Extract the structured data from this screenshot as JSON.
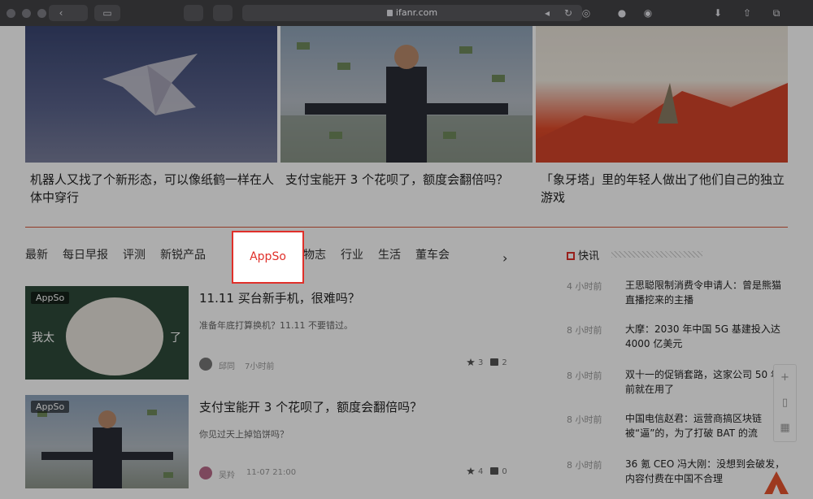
{
  "browser": {
    "url": "ifanr.com"
  },
  "hero": [
    {
      "title": "机器人又找了个新形态，可以像纸鹤一样在人体中穿行"
    },
    {
      "title": "支付宝能开 3 个花呗了，额度会翻倍吗？"
    },
    {
      "title": "「象牙塔」里的年轻人做出了他们自己的独立游戏"
    }
  ],
  "tabs": [
    "最新",
    "每日早报",
    "评测",
    "新锐产品",
    "AppSo",
    "玩物志",
    "行业",
    "生活",
    "董车会"
  ],
  "active_tab": "AppSo",
  "articles": [
    {
      "badge": "AppSo",
      "thumb_text_left": "我太",
      "thumb_text_right": "了",
      "title": "11.11 买台新手机，很难吗？",
      "desc": "准备年底打算换机？11.11 不要错过。",
      "author": "邱同",
      "time": "7小时前",
      "likes": "3",
      "comments": "2"
    },
    {
      "badge": "AppSo",
      "title": "支付宝能开 3 个花呗了，额度会翻倍吗？",
      "desc": "你见过天上掉馅饼吗？",
      "author": "吴羚",
      "time": "11-07 21:00",
      "likes": "4",
      "comments": "0"
    }
  ],
  "flash": {
    "title": "快讯",
    "items": [
      {
        "time": "4 小时前",
        "text": "王思聪限制消费令申请人：曾是熊猫直播挖来的主播"
      },
      {
        "time": "8 小时前",
        "text": "大摩：2030 年中国 5G 基建投入达 4000 亿美元"
      },
      {
        "time": "8 小时前",
        "text": "双十一的促销套路，这家公司 50 年前就在用了"
      },
      {
        "time": "8 小时前",
        "text": "中国电信赵君：运营商搞区块链被“逼”的，为了打破 BAT 的流"
      },
      {
        "time": "8 小时前",
        "text": "36 氪 CEO 冯大刚：没想到会破发，内容付费在中国不合理"
      }
    ]
  },
  "side_tools": [
    "+",
    "▯",
    "▦"
  ],
  "colors": {
    "accent": "#e0302a",
    "toolbar": "#2d2d2f"
  }
}
